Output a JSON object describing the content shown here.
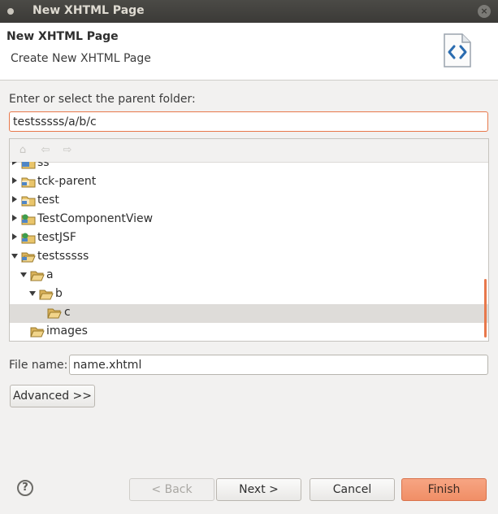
{
  "window": {
    "title": "New XHTML Page"
  },
  "header": {
    "title": "New XHTML Page",
    "description": "Create New XHTML Page",
    "icon": "xhtml-file-icon"
  },
  "folder": {
    "label": "Enter or select the parent folder:",
    "value": "testsssss/a/b/c"
  },
  "tree": {
    "toolbar": [
      "home-icon",
      "back-arrow-icon",
      "forward-arrow-icon"
    ],
    "items": [
      {
        "label": "ss",
        "depth": 0,
        "state": "collapsed",
        "icon": "project-folder-icon"
      },
      {
        "label": "tck-parent",
        "depth": 0,
        "state": "collapsed",
        "icon": "project-folder-icon"
      },
      {
        "label": "test",
        "depth": 0,
        "state": "collapsed",
        "icon": "project-folder-icon"
      },
      {
        "label": "TestComponentView",
        "depth": 0,
        "state": "collapsed",
        "icon": "java-project-icon"
      },
      {
        "label": "testJSF",
        "depth": 0,
        "state": "collapsed",
        "icon": "java-project-icon"
      },
      {
        "label": "testsssss",
        "depth": 0,
        "state": "expanded",
        "icon": "project-folder-open-icon"
      },
      {
        "label": "a",
        "depth": 1,
        "state": "expanded",
        "icon": "folder-open-icon"
      },
      {
        "label": "b",
        "depth": 2,
        "state": "expanded",
        "icon": "folder-open-icon"
      },
      {
        "label": "c",
        "depth": 3,
        "state": "leaf",
        "icon": "folder-open-icon",
        "selected": true
      },
      {
        "label": "images",
        "depth": 1,
        "state": "leaf",
        "icon": "folder-open-icon"
      }
    ]
  },
  "file": {
    "label": "File name:",
    "value": "name.xhtml"
  },
  "buttons": {
    "advanced": "Advanced >>",
    "back": "< Back",
    "next": "Next >",
    "cancel": "Cancel",
    "finish": "Finish"
  },
  "colors": {
    "accent": "#e8784b",
    "primary_button": "#f08e66",
    "selection": "#dedcd9"
  }
}
